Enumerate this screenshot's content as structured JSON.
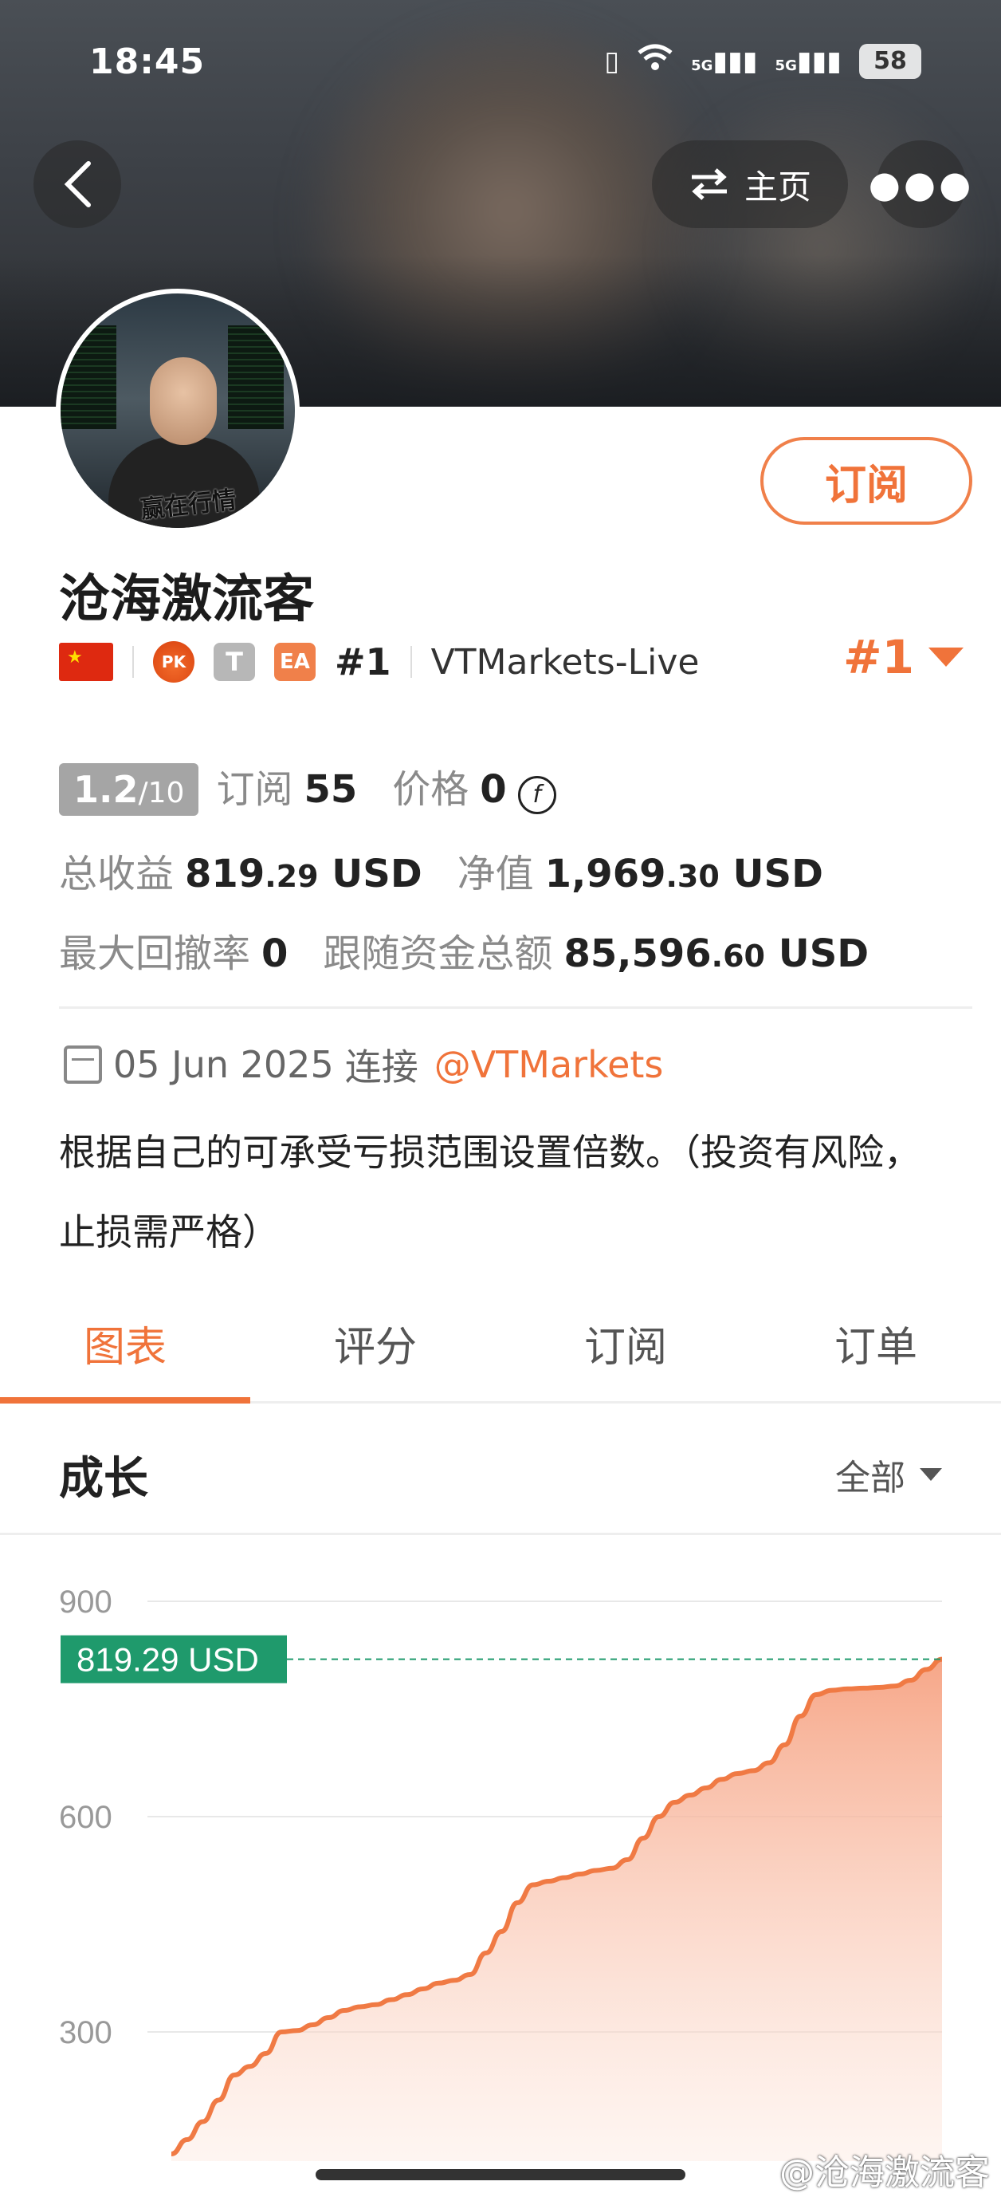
{
  "status": {
    "time": "18:45",
    "battery": "58",
    "signal1": "5G",
    "signal2": "5G"
  },
  "nav": {
    "home_label": "主页"
  },
  "profile": {
    "name": "沧海激流客",
    "subscribe_label": "订阅",
    "badges": {
      "pk": "PK",
      "t": "T",
      "ea": "EA"
    },
    "rank": "#1",
    "server": "VTMarkets-Live",
    "rank_right": "#1",
    "avatar_signature": "赢在行情"
  },
  "stats": {
    "score_main": "1.2",
    "score_sub": "/10",
    "subscribe_label": "订阅",
    "subscribe_count": "55",
    "price_label": "价格",
    "price_value": "0",
    "total_profit_label": "总收益",
    "total_profit_int": "819",
    "total_profit_dec": ".29",
    "usd": "USD",
    "equity_label": "净值",
    "equity_int": "1,969",
    "equity_dec": ".30",
    "drawdown_label": "最大回撤率",
    "drawdown_value": "0",
    "follow_label": "跟随资金总额",
    "follow_int": "85,596",
    "follow_dec": ".60"
  },
  "connect": {
    "date": "05 Jun 2025",
    "label": "连接",
    "broker": "@VTMarkets"
  },
  "description_line1": "根据自己的可承受亏损范围设置倍数。（投资有风险，",
  "description_line2": "止损需严格）",
  "tabs": [
    "图表",
    "评分",
    "订阅",
    "订单"
  ],
  "section": {
    "title": "成长",
    "filter": "全部"
  },
  "chart_data": {
    "type": "area",
    "y_ticks": [
      "900",
      "600",
      "300"
    ],
    "ylim": [
      120,
      920
    ],
    "current_label": "819.29 USD",
    "current_value": 819.29,
    "values": [
      130,
      150,
      175,
      205,
      240,
      252,
      270,
      300,
      302,
      310,
      320,
      330,
      335,
      338,
      345,
      352,
      360,
      368,
      372,
      380,
      410,
      440,
      480,
      505,
      510,
      515,
      520,
      525,
      528,
      540,
      570,
      600,
      620,
      630,
      640,
      652,
      660,
      664,
      675,
      700,
      740,
      770,
      776,
      778,
      779,
      780,
      782,
      790,
      805,
      819.29
    ],
    "colors": {
      "line": "#f07a44",
      "fill_top": "#f6a282",
      "label_bg": "#1f9a6c"
    }
  },
  "watermark": "@沧海激流客"
}
